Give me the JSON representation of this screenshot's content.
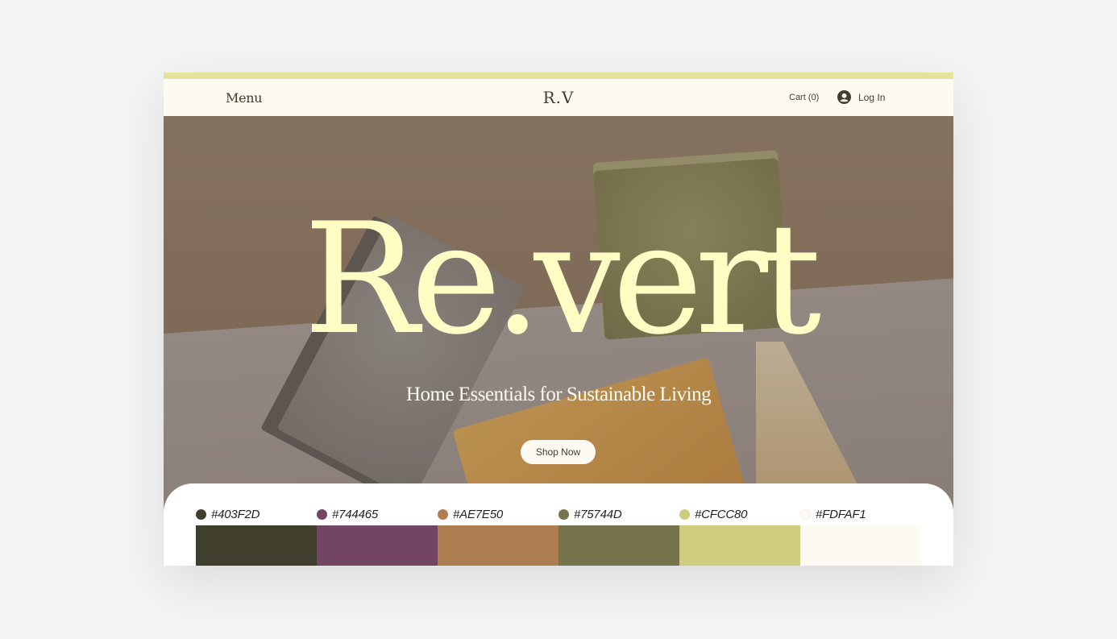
{
  "header": {
    "menu_label": "Menu",
    "logo": "R.V",
    "cart_label": "Cart (0)",
    "login_label": "Log In"
  },
  "hero": {
    "title": "Re.vert",
    "tagline": "Home Essentials for Sustainable Living",
    "cta_label": "Shop Now"
  },
  "colors": {
    "accent_bar": "#E3E39C",
    "title_color": "#FFFDC3"
  },
  "palette": [
    {
      "code": "#403F2D"
    },
    {
      "code": "#744465"
    },
    {
      "code": "#AE7E50"
    },
    {
      "code": "#75744D"
    },
    {
      "code": "#CFCC80"
    },
    {
      "code": "#FDFAF1"
    }
  ]
}
